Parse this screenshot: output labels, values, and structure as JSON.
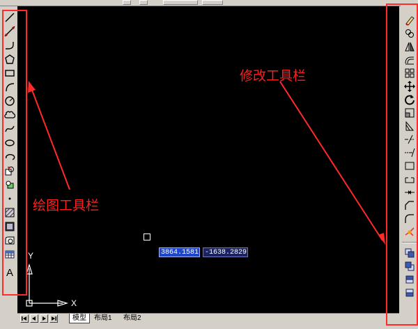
{
  "annotations": {
    "draw_toolbar_label": "绘图工具栏",
    "modify_toolbar_label": "修改工具栏",
    "annotation_color": "#ff1e1e"
  },
  "dynamic_input": {
    "x_value": "3864.1581",
    "y_value": "-1638.2829"
  },
  "ucs": {
    "x_label": "X",
    "y_label": "Y"
  },
  "layout_tabs": [
    {
      "label": "模型",
      "active": true
    },
    {
      "label": "布局1",
      "active": false
    },
    {
      "label": "布局2",
      "active": false
    }
  ],
  "draw_toolbar": {
    "items": [
      "line-icon",
      "construction-line-icon",
      "polyline-icon",
      "polygon-icon",
      "rectangle-icon",
      "arc-icon",
      "circle-icon",
      "revision-cloud-icon",
      "spline-icon",
      "ellipse-icon",
      "ellipse-arc-icon",
      "insert-block-icon",
      "make-block-icon",
      "point-icon",
      "hatch-icon",
      "gradient-icon",
      "region-icon",
      "table-icon",
      "multiline-text-icon"
    ],
    "text_button_glyph": "A"
  },
  "modify_toolbar": {
    "items": [
      "erase-icon",
      "copy-icon",
      "mirror-icon",
      "offset-icon",
      "array-icon",
      "move-icon",
      "rotate-icon",
      "scale-icon",
      "stretch-icon",
      "trim-icon",
      "extend-icon",
      "break-at-point-icon",
      "break-icon",
      "join-icon",
      "chamfer-icon",
      "fillet-icon",
      "explode-icon"
    ],
    "draworder_items": [
      "bring-to-front-icon",
      "send-to-back-icon",
      "bring-above-icon",
      "send-under-icon"
    ]
  }
}
